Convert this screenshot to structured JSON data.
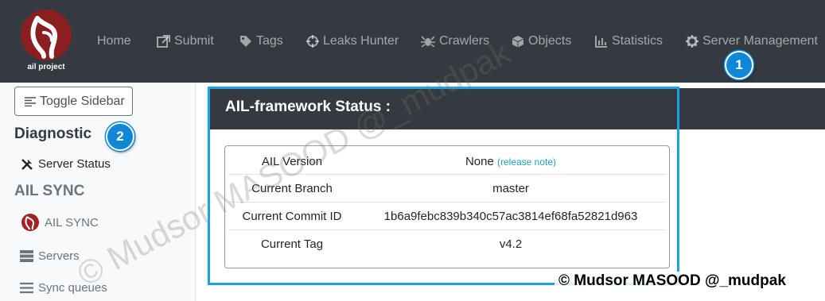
{
  "logo": {
    "text": "ail project"
  },
  "nav": {
    "items": [
      {
        "label": "Home",
        "icon": "home"
      },
      {
        "label": "Submit",
        "icon": "external-link-icon"
      },
      {
        "label": "Tags",
        "icon": "tag-icon"
      },
      {
        "label": "Leaks Hunter",
        "icon": "crosshairs-icon"
      },
      {
        "label": "Crawlers",
        "icon": "spider-icon"
      },
      {
        "label": "Objects",
        "icon": "cube-icon"
      },
      {
        "label": "Statistics",
        "icon": "bar-chart-icon"
      },
      {
        "label": "Server Management",
        "icon": "gear-icon"
      }
    ]
  },
  "annotations": {
    "badge1": "1",
    "badge2": "2"
  },
  "sidebar": {
    "toggle_label": "Toggle Sidebar",
    "diagnostic_heading": "Diagnostic",
    "server_status_label": "Server Status",
    "ail_sync_heading": "AIL SYNC",
    "ail_sync_label": "AIL SYNC",
    "servers_label": "Servers",
    "sync_queues_label": "Sync queues"
  },
  "status_card": {
    "title": "AIL-framework Status :",
    "rows": [
      {
        "key": "AIL Version",
        "value": "None",
        "note": "(release note)"
      },
      {
        "key": "Current Branch",
        "value": "master"
      },
      {
        "key": "Current Commit ID",
        "value": "1b6a9febc839b340c57ac3814ef68fa52821d963"
      },
      {
        "key": "Current Tag",
        "value": "v4.2"
      }
    ]
  },
  "watermark": "© Mudsor MASOOD @_mudpak",
  "copyright": "© Mudsor MASOOD @_mudpak",
  "colors": {
    "navbar": "#343a40",
    "highlight": "#1aa3e8",
    "badge": "#0f86d6",
    "link_note": "#17a2b8"
  }
}
